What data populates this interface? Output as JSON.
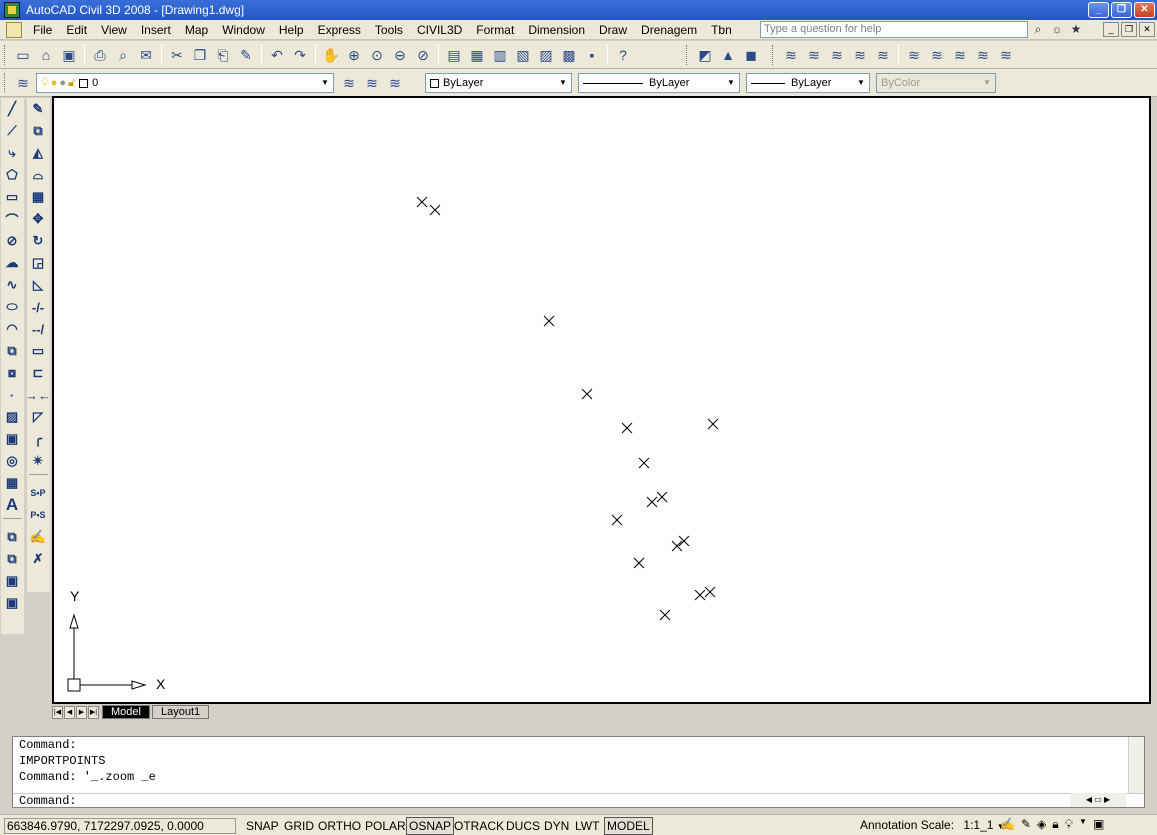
{
  "window": {
    "title": "AutoCAD Civil 3D 2008 - [Drawing1.dwg]"
  },
  "menubar": {
    "items": [
      "File",
      "Edit",
      "View",
      "Insert",
      "Map",
      "Window",
      "Help",
      "Express",
      "Tools",
      "CIVIL3D",
      "Format",
      "Dimension",
      "Draw",
      "Drenagem",
      "Tbn"
    ]
  },
  "help": {
    "placeholder": "Type a question for help"
  },
  "properties": {
    "layer": "0",
    "color": "ByLayer",
    "linetype": "ByLayer",
    "lineweight": "ByLayer",
    "plotstyle": "ByColor"
  },
  "drawing": {
    "ucs_x": "X",
    "ucs_y": "Y",
    "points_marker": "×"
  },
  "tabs": {
    "model": "Model",
    "layout1": "Layout1"
  },
  "command": {
    "history": [
      "Command:",
      "IMPORTPOINTS",
      "Command: '_.zoom _e"
    ],
    "prompt": "Command:"
  },
  "status": {
    "coords": "663846.9790, 7172297.0925, 0.0000",
    "toggles": [
      "SNAP",
      "GRID",
      "ORTHO",
      "POLAR",
      "OSNAP",
      "OTRACK",
      "DUCS",
      "DYN",
      "LWT",
      "MODEL"
    ],
    "toggles_on": [
      "OSNAP",
      "MODEL"
    ],
    "annotation_label": "Annotation Scale:",
    "annotation_value": "1:1_1"
  }
}
